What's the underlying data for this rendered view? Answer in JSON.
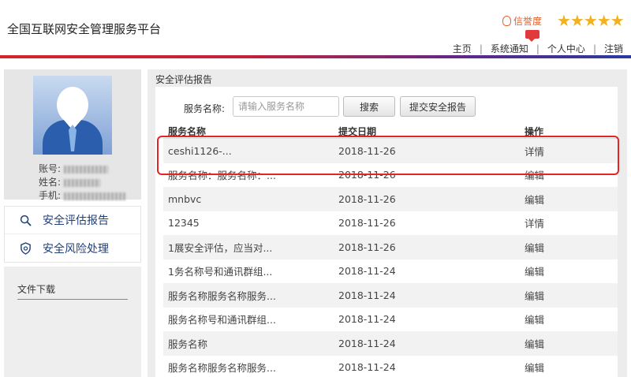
{
  "header": {
    "title": "全国互联网安全管理服务平台",
    "credit_label": "信誉度",
    "stars": "★★★★★",
    "nav": [
      "主页",
      "系统通知",
      "个人中心",
      "注销"
    ]
  },
  "profile": {
    "account_label": "账号:",
    "name_label": "姓名:",
    "phone_label": "手机:"
  },
  "menu": {
    "items": [
      {
        "label": "安全评估报告",
        "icon": "search-icon"
      },
      {
        "label": "安全风险处理",
        "icon": "shield-icon"
      }
    ],
    "downloads_label": "文件下载"
  },
  "panel": {
    "title": "安全评估报告",
    "search_label": "服务名称:",
    "search_placeholder": "请输入服务名称",
    "search_button": "搜索",
    "submit_button": "提交安全报告"
  },
  "table": {
    "headers": [
      "服务名称",
      "提交日期",
      "操作"
    ],
    "rows": [
      {
        "name": "ceshi1126-...",
        "date": "2018-11-26",
        "op": "详情"
      },
      {
        "name": "服务名称：服务名称：...",
        "date": "2018-11-26",
        "op": "编辑"
      },
      {
        "name": "mnbvc",
        "date": "2018-11-26",
        "op": "编辑"
      },
      {
        "name": "12345",
        "date": "2018-11-26",
        "op": "详情"
      },
      {
        "name": "1展安全评估，应当对...",
        "date": "2018-11-26",
        "op": "编辑"
      },
      {
        "name": "1务名称号和通讯群组...",
        "date": "2018-11-24",
        "op": "编辑"
      },
      {
        "name": "服务名称服务名称服务...",
        "date": "2018-11-24",
        "op": "编辑"
      },
      {
        "name": "服务名称号和通讯群组...",
        "date": "2018-11-24",
        "op": "编辑"
      },
      {
        "name": "服务名称",
        "date": "2018-11-24",
        "op": "编辑"
      },
      {
        "name": "服务名称服务名称服务...",
        "date": "2018-11-24",
        "op": "编辑"
      }
    ]
  },
  "colors": {
    "accent_red": "#d8232a",
    "accent_blue": "#2a3aa0",
    "star": "#f3b01f",
    "highlight": "#e52424"
  }
}
